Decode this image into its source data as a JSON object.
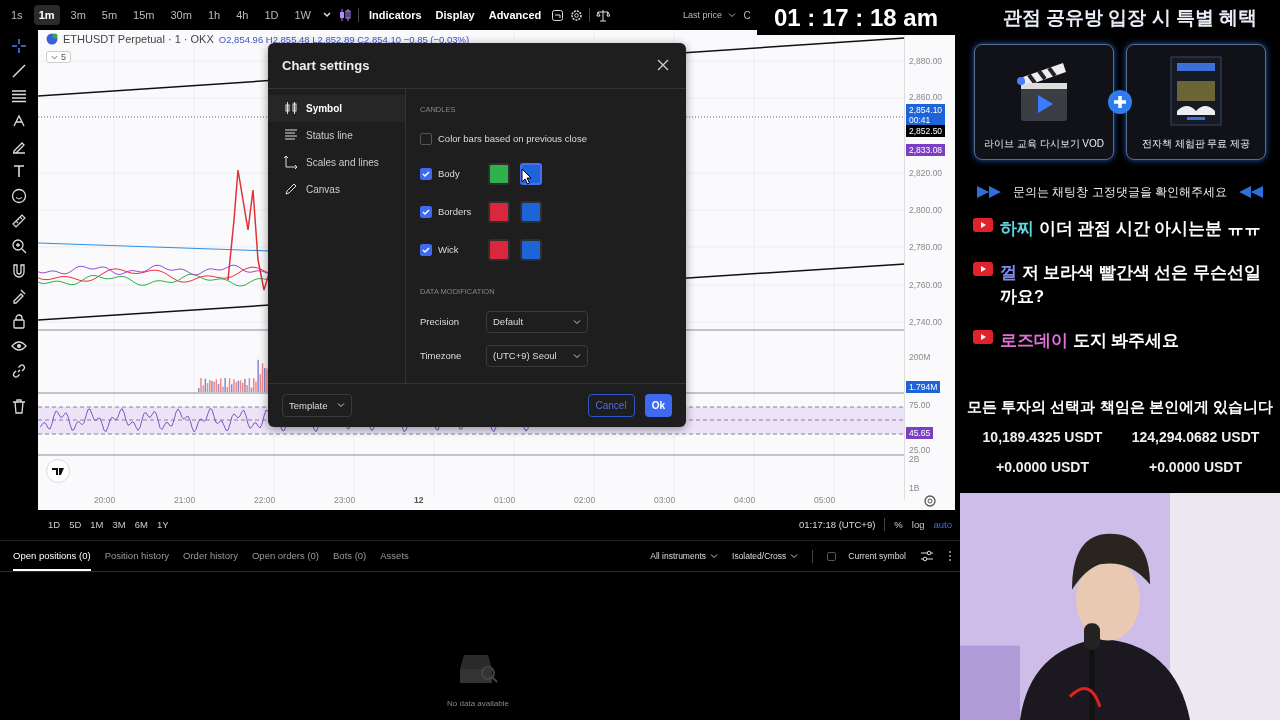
{
  "toolbar": {
    "intervals": [
      {
        "label": "1s",
        "selected": false
      },
      {
        "label": "1m",
        "selected": true
      },
      {
        "label": "3m",
        "selected": false
      },
      {
        "label": "5m",
        "selected": false
      },
      {
        "label": "15m",
        "selected": false
      },
      {
        "label": "30m",
        "selected": false
      },
      {
        "label": "1h",
        "selected": false
      },
      {
        "label": "4h",
        "selected": false
      },
      {
        "label": "1D",
        "selected": false
      },
      {
        "label": "1W",
        "selected": false
      }
    ],
    "buttons": [
      "Indicators",
      "Display",
      "Advanced"
    ],
    "price_source": "Last price",
    "cut_button": "C"
  },
  "clock": "01 : 17 : 18 am",
  "legend": {
    "symbol": "ETHUSDT Perpetual · 1 · OKX",
    "ohlc": "O2,854.96 H2,855.48 L2,852.89 C2,854.10 −0.85 (−0.03%)",
    "indicator_count": "5"
  },
  "price_axis": [
    {
      "text": "2,880.00",
      "kind": "tick"
    },
    {
      "text": "2,860.00",
      "kind": "tick"
    },
    {
      "text": "2,854.10\n00:41",
      "kind": "badge",
      "color": "#1e63d8"
    },
    {
      "text": "2,852.50",
      "kind": "badge",
      "color": "#000000"
    },
    {
      "text": "2,833.08",
      "kind": "badge",
      "color": "#7b3fc4"
    },
    {
      "text": "2,820.00",
      "kind": "tick"
    },
    {
      "text": "2,800.00",
      "kind": "tick"
    },
    {
      "text": "2,780.00",
      "kind": "tick"
    },
    {
      "text": "2,760.00",
      "kind": "tick"
    },
    {
      "text": "2,740.00",
      "kind": "tick"
    },
    {
      "text": "200M",
      "kind": "tick"
    },
    {
      "text": "1.794M",
      "kind": "badge",
      "color": "#1e63d8"
    },
    {
      "text": "75.00",
      "kind": "tick"
    },
    {
      "text": "45.65",
      "kind": "badge",
      "color": "#7b3fc4"
    },
    {
      "text": "25.00",
      "kind": "tick"
    },
    {
      "text": "2B",
      "kind": "tick"
    },
    {
      "text": "1B",
      "kind": "tick"
    }
  ],
  "time_axis": [
    {
      "text": "20:00",
      "bold": false
    },
    {
      "text": "21:00",
      "bold": false
    },
    {
      "text": "22:00",
      "bold": false
    },
    {
      "text": "23:00",
      "bold": false
    },
    {
      "text": "12",
      "bold": true
    },
    {
      "text": "01:00",
      "bold": false
    },
    {
      "text": "02:00",
      "bold": false
    },
    {
      "text": "03:00",
      "bold": false
    },
    {
      "text": "04:00",
      "bold": false
    },
    {
      "text": "05:00",
      "bold": false
    }
  ],
  "dialog": {
    "title": "Chart settings",
    "nav": [
      {
        "label": "Symbol",
        "selected": true,
        "kind": "candles"
      },
      {
        "label": "Status line",
        "selected": false,
        "kind": "lines"
      },
      {
        "label": "Scales and lines",
        "selected": false,
        "kind": "axes"
      },
      {
        "label": "Canvas",
        "selected": false,
        "kind": "pencil"
      }
    ],
    "candles_heading": "CANDLES",
    "color_bars": {
      "label": "Color bars based on previous close",
      "checked": false
    },
    "rows": [
      {
        "label": "Body",
        "checked": true,
        "swatches": [
          {
            "color": "#2fb24c",
            "focused": false
          },
          {
            "color": "#1e63d8",
            "focused": true
          }
        ]
      },
      {
        "label": "Borders",
        "checked": true,
        "swatches": [
          {
            "color": "#d9273e",
            "focused": false
          },
          {
            "color": "#1e63d8",
            "focused": false
          }
        ]
      },
      {
        "label": "Wick",
        "checked": true,
        "swatches": [
          {
            "color": "#d9273e",
            "focused": false
          },
          {
            "color": "#1e63d8",
            "focused": false
          }
        ]
      }
    ],
    "data_heading": "DATA MODIFICATION",
    "fields": [
      {
        "label": "Precision",
        "value": "Default"
      },
      {
        "label": "Timezone",
        "value": "(UTC+9) Seoul"
      }
    ],
    "template": "Template",
    "cancel": "Cancel",
    "ok": "Ok"
  },
  "range_bar": {
    "ranges": [
      "1D",
      "5D",
      "1M",
      "3M",
      "6M",
      "1Y"
    ],
    "time": "01:17:18 (UTC+9)",
    "modes": [
      {
        "label": "%",
        "selected": false
      },
      {
        "label": "log",
        "selected": false
      },
      {
        "label": "auto",
        "selected": true
      }
    ]
  },
  "positions": {
    "tabs": [
      {
        "label": "Open positions (0)",
        "selected": true
      },
      {
        "label": "Position history",
        "selected": false
      },
      {
        "label": "Order history",
        "selected": false
      },
      {
        "label": "Open orders (0)",
        "selected": false
      },
      {
        "label": "Bots (0)",
        "selected": false
      },
      {
        "label": "Assets",
        "selected": false
      }
    ],
    "filters": [
      "All instruments",
      "Isolated/Cross"
    ],
    "current_symbol": {
      "label": "Current symbol",
      "checked": false
    },
    "empty": "No data available"
  },
  "promo": {
    "title": "관점 공유방 입장 시 특별 혜택",
    "cards": [
      "라이브 교육 다시보기 VOD",
      "전자책 체험판 무료 제공"
    ],
    "notice": "문의는 채팅창 고정댓글을 확인해주세요"
  },
  "chat": [
    {
      "user": "하찌",
      "color": "#5fd3e0",
      "text": "이더 관점 시간 아시는분 ㅠㅠ"
    },
    {
      "user": "껄",
      "color": "#7f8cf0",
      "text": "저 보라색 빨간색 선은 무슨선일까요?"
    },
    {
      "user": "로즈데이",
      "color": "#e070d8",
      "text": "도지 봐주세요"
    }
  ],
  "disclaimer": "모든 투자의 선택과 책임은 본인에게 있습니다",
  "balances": [
    "10,189.4325 USDT",
    "124,294.0682 USDT",
    "+0.0000 USDT",
    "+0.0000 USDT"
  ]
}
